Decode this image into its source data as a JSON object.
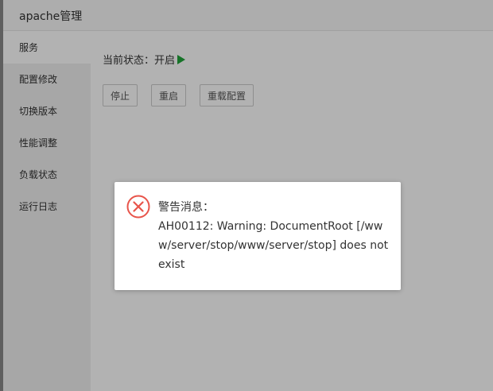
{
  "window": {
    "title": "apache管理"
  },
  "sidebar": {
    "items": [
      {
        "label": "服务",
        "active": true
      },
      {
        "label": "配置修改"
      },
      {
        "label": "切换版本"
      },
      {
        "label": "性能调整"
      },
      {
        "label": "负载状态"
      },
      {
        "label": "运行日志"
      }
    ]
  },
  "service": {
    "status_label": "当前状态：",
    "status_value": "开启",
    "status_icon": "play-icon",
    "status_color": "#20a53a",
    "buttons": {
      "stop": "停止",
      "restart": "重启",
      "reload": "重载配置"
    }
  },
  "dialog": {
    "icon": "error-icon",
    "icon_color": "#e8544a",
    "title": "警告消息：",
    "message": "AH00112: Warning: DocumentRoot [/www/server/stop/www/server/stop] does not exist"
  }
}
